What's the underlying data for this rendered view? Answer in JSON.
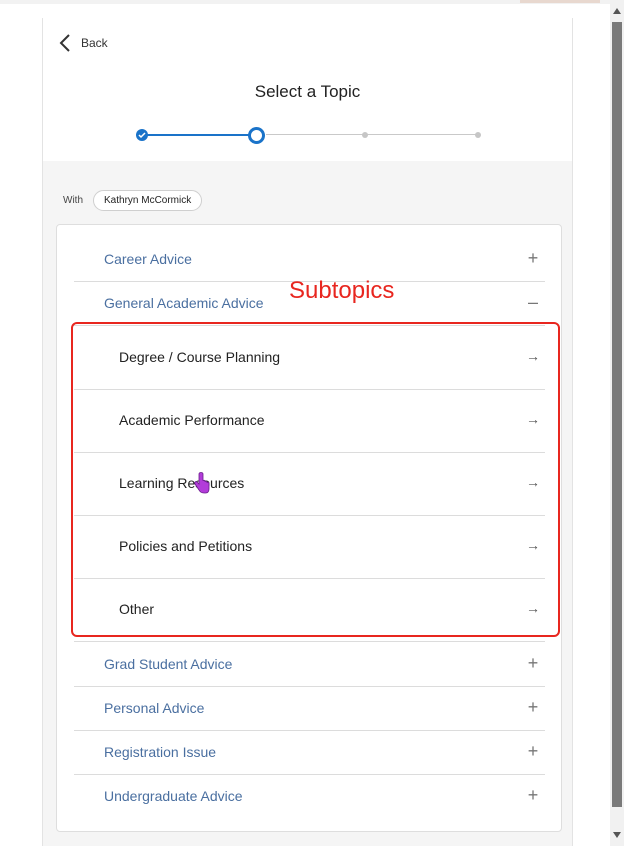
{
  "header": {
    "back_label": "Back",
    "title": "Select a Topic",
    "stepper": {
      "total_steps": 4,
      "current_step": 2
    }
  },
  "with": {
    "label": "With",
    "advisor": "Kathryn McCormick"
  },
  "topics": {
    "top": [
      {
        "label": "Career Advice",
        "state": "+"
      },
      {
        "label": "General Academic Advice",
        "state": "–"
      }
    ],
    "subtopics": [
      {
        "label": "Degree / Course Planning",
        "arrow": "→"
      },
      {
        "label": "Academic Performance",
        "arrow": "→"
      },
      {
        "label": "Learning Resources",
        "arrow": "→"
      },
      {
        "label": "Policies and Petitions",
        "arrow": "→"
      },
      {
        "label": "Other",
        "arrow": "→"
      }
    ],
    "bottom": [
      {
        "label": "Grad Student Advice",
        "state": "+"
      },
      {
        "label": "Personal Advice",
        "state": "+"
      },
      {
        "label": "Registration Issue",
        "state": "+"
      },
      {
        "label": "Undergraduate Advice",
        "state": "+"
      }
    ]
  },
  "annotation": {
    "label": "Subtopics",
    "color": "#e8261f"
  },
  "colors": {
    "accent": "#1a73c9",
    "topic_link": "#4a6fa0"
  },
  "icons": {
    "back": "chevron-left-icon",
    "step_done": "check-icon",
    "cursor": "hand-pointer-icon"
  }
}
